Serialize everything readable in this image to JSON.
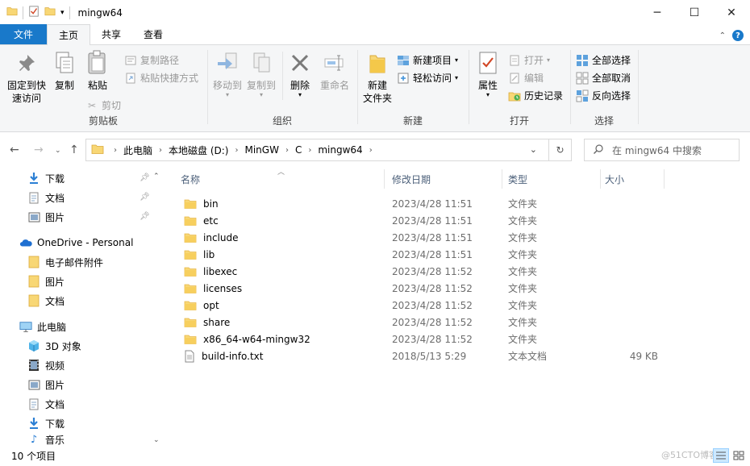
{
  "window": {
    "title": "mingw64"
  },
  "tabs": [
    {
      "label": "文件"
    },
    {
      "label": "主页"
    },
    {
      "label": "共享"
    },
    {
      "label": "查看"
    }
  ],
  "ribbon": {
    "clipboard": {
      "label": "剪贴板",
      "pin": "固定到快\n速访问",
      "pin_l1": "固定到快",
      "pin_l2": "速访问",
      "copy": "复制",
      "paste": "粘贴",
      "copy_path": "复制路径",
      "paste_shortcut": "粘贴快捷方式",
      "cut": "剪切"
    },
    "organize": {
      "label": "组织",
      "move_to": "移动到",
      "copy_to": "复制到",
      "delete": "删除",
      "rename": "重命名"
    },
    "new": {
      "label": "新建",
      "new_folder_l1": "新建",
      "new_folder_l2": "文件夹",
      "new_item": "新建项目",
      "easy_access": "轻松访问"
    },
    "open": {
      "label": "打开",
      "properties": "属性",
      "open": "打开",
      "edit": "编辑",
      "history": "历史记录"
    },
    "select": {
      "label": "选择",
      "select_all": "全部选择",
      "select_none": "全部取消",
      "invert": "反向选择"
    }
  },
  "address": {
    "crumbs": [
      "此电脑",
      "本地磁盘 (D:)",
      "MinGW",
      "C",
      "mingw64"
    ],
    "search_placeholder": "在 mingw64 中搜索"
  },
  "nav": {
    "quick_access": [
      {
        "label": "下载",
        "icon": "download-icon"
      },
      {
        "label": "文档",
        "icon": "document-icon"
      },
      {
        "label": "图片",
        "icon": "picture-icon"
      }
    ],
    "onedrive": "OneDrive - Personal",
    "onedrive_items": [
      {
        "label": "电子邮件附件"
      },
      {
        "label": "图片"
      },
      {
        "label": "文档"
      }
    ],
    "this_pc": "此电脑",
    "pc_items": [
      {
        "label": "3D 对象"
      },
      {
        "label": "视频"
      },
      {
        "label": "图片"
      },
      {
        "label": "文档"
      },
      {
        "label": "下载"
      },
      {
        "label": "音乐"
      }
    ]
  },
  "list": {
    "columns": {
      "name": "名称",
      "date": "修改日期",
      "type": "类型",
      "size": "大小"
    },
    "rows": [
      {
        "name": "bin",
        "date": "2023/4/28 11:51",
        "type": "文件夹",
        "size": "",
        "icon": "folder-icon"
      },
      {
        "name": "etc",
        "date": "2023/4/28 11:51",
        "type": "文件夹",
        "size": "",
        "icon": "folder-icon"
      },
      {
        "name": "include",
        "date": "2023/4/28 11:51",
        "type": "文件夹",
        "size": "",
        "icon": "folder-icon"
      },
      {
        "name": "lib",
        "date": "2023/4/28 11:51",
        "type": "文件夹",
        "size": "",
        "icon": "folder-icon"
      },
      {
        "name": "libexec",
        "date": "2023/4/28 11:52",
        "type": "文件夹",
        "size": "",
        "icon": "folder-icon"
      },
      {
        "name": "licenses",
        "date": "2023/4/28 11:52",
        "type": "文件夹",
        "size": "",
        "icon": "folder-icon"
      },
      {
        "name": "opt",
        "date": "2023/4/28 11:52",
        "type": "文件夹",
        "size": "",
        "icon": "folder-icon"
      },
      {
        "name": "share",
        "date": "2023/4/28 11:52",
        "type": "文件夹",
        "size": "",
        "icon": "folder-icon"
      },
      {
        "name": "x86_64-w64-mingw32",
        "date": "2023/4/28 11:52",
        "type": "文件夹",
        "size": "",
        "icon": "folder-icon"
      },
      {
        "name": "build-info.txt",
        "date": "2018/5/13 5:29",
        "type": "文本文档",
        "size": "49 KB",
        "icon": "text-file-icon"
      }
    ]
  },
  "status": {
    "count": "10 个项目",
    "watermark": "@51CTO博客"
  },
  "colors": {
    "accent": "#1979ca",
    "folder": "#f8d775",
    "folder_dark": "#e8b84a"
  }
}
